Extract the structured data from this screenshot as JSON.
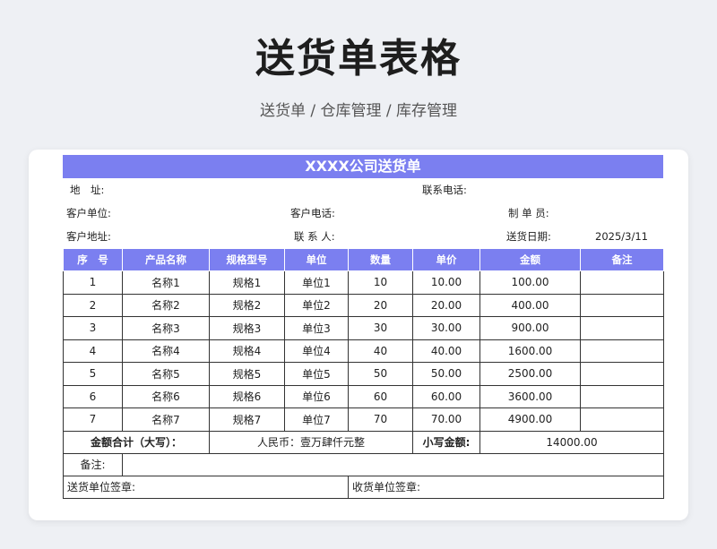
{
  "page": {
    "title": "送货单表格",
    "subtitle": "送货单 / 仓库管理 / 库存管理"
  },
  "doc": {
    "title": "XXXX公司送货单",
    "address_label": "地　址:",
    "contact_phone_label": "联系电话:",
    "customer_unit_label": "客户单位:",
    "customer_phone_label": "客户电话:",
    "maker_label": "制 单 员:",
    "customer_address_label": "客户地址:",
    "contact_person_label": "联 系 人:",
    "delivery_date_label": "送货日期:",
    "delivery_date": "2025/3/11"
  },
  "table": {
    "headers": [
      "序　号",
      "产品名称",
      "规格型号",
      "单位",
      "数量",
      "单价",
      "金额",
      "备注"
    ],
    "rows": [
      [
        "1",
        "名称1",
        "规格1",
        "单位1",
        "10",
        "10.00",
        "100.00",
        ""
      ],
      [
        "2",
        "名称2",
        "规格2",
        "单位2",
        "20",
        "20.00",
        "400.00",
        ""
      ],
      [
        "3",
        "名称3",
        "规格3",
        "单位3",
        "30",
        "30.00",
        "900.00",
        ""
      ],
      [
        "4",
        "名称4",
        "规格4",
        "单位4",
        "40",
        "40.00",
        "1600.00",
        ""
      ],
      [
        "5",
        "名称5",
        "规格5",
        "单位5",
        "50",
        "50.00",
        "2500.00",
        ""
      ],
      [
        "6",
        "名称6",
        "规格6",
        "单位6",
        "60",
        "60.00",
        "3600.00",
        ""
      ],
      [
        "7",
        "名称7",
        "规格7",
        "单位7",
        "70",
        "70.00",
        "4900.00",
        ""
      ]
    ]
  },
  "totals": {
    "label": "金额合计（大写）：",
    "rmb_text": "人民币：壹万肆仟元整",
    "small_label": "小写金额:",
    "small_value": "14000.00"
  },
  "remarks_label": "备注:",
  "signatures": {
    "sender": "送货单位签章:",
    "receiver": "收货单位签章:"
  }
}
